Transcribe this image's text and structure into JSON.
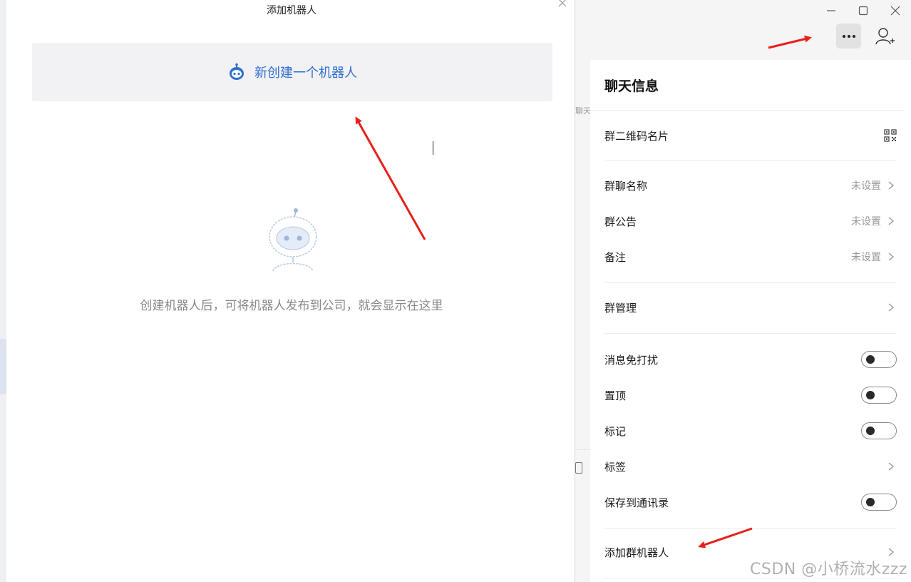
{
  "dialog": {
    "title": "添加机器人",
    "create_label": "新创建一个机器人",
    "empty_text": "创建机器人后，可将机器人发布到公司，就会显示在这里"
  },
  "background": {
    "side_hint": "聊天"
  },
  "chat_info": {
    "title": "聊天信息",
    "items": [
      {
        "label": "群二维码名片",
        "icon": "qr-code-icon"
      },
      {
        "label": "群聊名称",
        "value": "未设置"
      },
      {
        "label": "群公告",
        "value": "未设置"
      },
      {
        "label": "备注",
        "value": "未设置"
      },
      {
        "label": "群管理"
      },
      {
        "label": "消息免打扰",
        "toggle": false
      },
      {
        "label": "置顶",
        "toggle": false
      },
      {
        "label": "标记",
        "toggle": false
      },
      {
        "label": "标签"
      },
      {
        "label": "保存到通讯录",
        "toggle": false
      },
      {
        "label": "添加群机器人"
      }
    ]
  },
  "colors": {
    "accent": "#2f6fd0",
    "arrow": "#e8201c"
  },
  "watermark": "CSDN @小桥流水zzz"
}
